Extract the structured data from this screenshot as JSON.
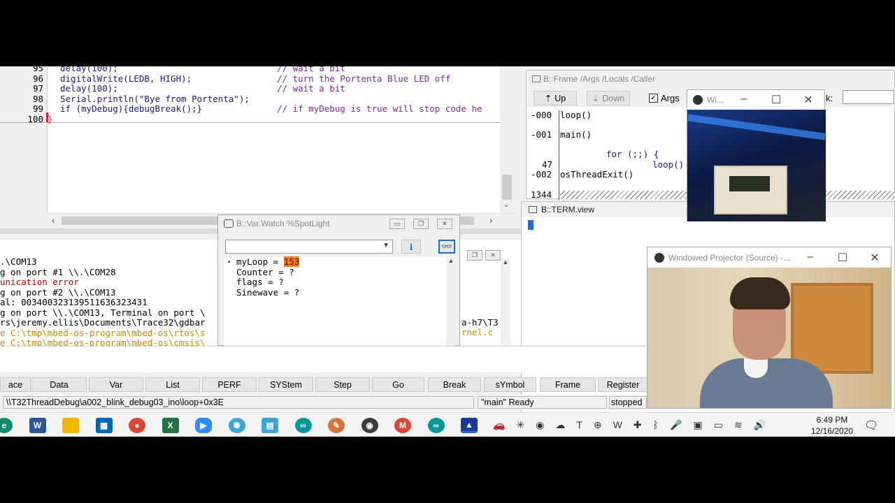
{
  "editor": {
    "lines": [
      {
        "num": "95",
        "code": "delay(100);",
        "comment": "// wait a bit"
      },
      {
        "num": "96",
        "code": "digitalWrite(LEDB, HIGH);",
        "comment": "// turn the Portenta Blue LED off"
      },
      {
        "num": "97",
        "code": "delay(100);",
        "comment": "// wait a bit"
      },
      {
        "num": "98",
        "code": "Serial.println(\"Bye from Portenta\");",
        "comment": ""
      },
      {
        "num": "99",
        "code": "if (myDebug){debugBreak();}",
        "comment": "// if myDebug is true will stop code he"
      },
      {
        "num": "100",
        "code": "}",
        "comment": ""
      }
    ]
  },
  "frame_window": {
    "title": "B::Frame /Args /Locals /Caller",
    "up_label": "Up",
    "down_label": "Down",
    "args_label": "Args",
    "task_label": "k:",
    "rows": [
      {
        "num": "-000",
        "text": "loop()"
      },
      {
        "num": "-001",
        "text": "main()"
      },
      {
        "num": "",
        "text": "for (;;) {"
      },
      {
        "num": "47",
        "text": "loop()"
      },
      {
        "num": "-002",
        "text": "osThreadExit()"
      },
      {
        "num": "1344",
        "text": ""
      }
    ]
  },
  "small_projector": {
    "title": "Wi..."
  },
  "term_window": {
    "title": "B::TERM.view"
  },
  "var_watch": {
    "title": "B::Var.Watch %SpotLight",
    "vars": [
      {
        "name": "myLoop",
        "value": "153"
      },
      {
        "name": "Counter",
        "value": "?"
      },
      {
        "name": "flags",
        "value": "?"
      },
      {
        "name": "Sinewave",
        "value": "?"
      }
    ]
  },
  "log": {
    "lines": [
      ".\\COM13",
      "g on port #1 \\\\.\\COM28",
      "unication error",
      "g on port #2 \\\\.\\COM13",
      "al: 003400323139511636323431",
      "g on port \\\\.\\COM13, Terminal on port \\",
      "rs\\jeremy.ellis\\Documents\\Trace32\\gdbar",
      "e C:\\tmp\\mbed-os-program\\mbed-os\\rtos\\s",
      "e C:\\tmp\\mbed-os-program\\mbed-os\\cmsis\\"
    ],
    "right_1": "a-h7\\T3",
    "right_2": "rnel.c"
  },
  "projector": {
    "title": "Windowed Projector (Source) -..."
  },
  "toolbar": {
    "buttons": [
      "ace",
      "Data",
      "Var",
      "List",
      "PERF",
      "SYStem",
      "Step",
      "Go",
      "Break",
      "sYmbol",
      "Frame",
      "Register"
    ]
  },
  "status": {
    "path": "\\\\T32ThreadDebug\\a002_blink_debug03_ino\\loop+0x3E",
    "state": "\"main\" Ready",
    "stopped": "stopped"
  },
  "taskbar": {
    "time": "6:49 PM",
    "date": "12/16/2020",
    "icons": [
      "edge-icon",
      "word-icon",
      "folder-icon",
      "store-icon",
      "chrome-icon",
      "excel-icon",
      "zoom-icon",
      "obs-icon",
      "notepad-icon",
      "arduino-icon",
      "paint-icon",
      "obs2-icon",
      "chrome2-icon",
      "arduino2-icon",
      "trace32-icon"
    ],
    "colors": {
      "edge": "#0c8a6a",
      "word": "#2b579a",
      "folder": "#f2b800",
      "store": "#0067b8",
      "chrome": "#db4437",
      "excel": "#217346",
      "zoom": "#2d8cff",
      "obs": "#3b3b3b",
      "notepad": "#3ba5d8",
      "arduino": "#00979c",
      "paint": "#d8733a",
      "trace32": "#1a3b8c"
    }
  }
}
